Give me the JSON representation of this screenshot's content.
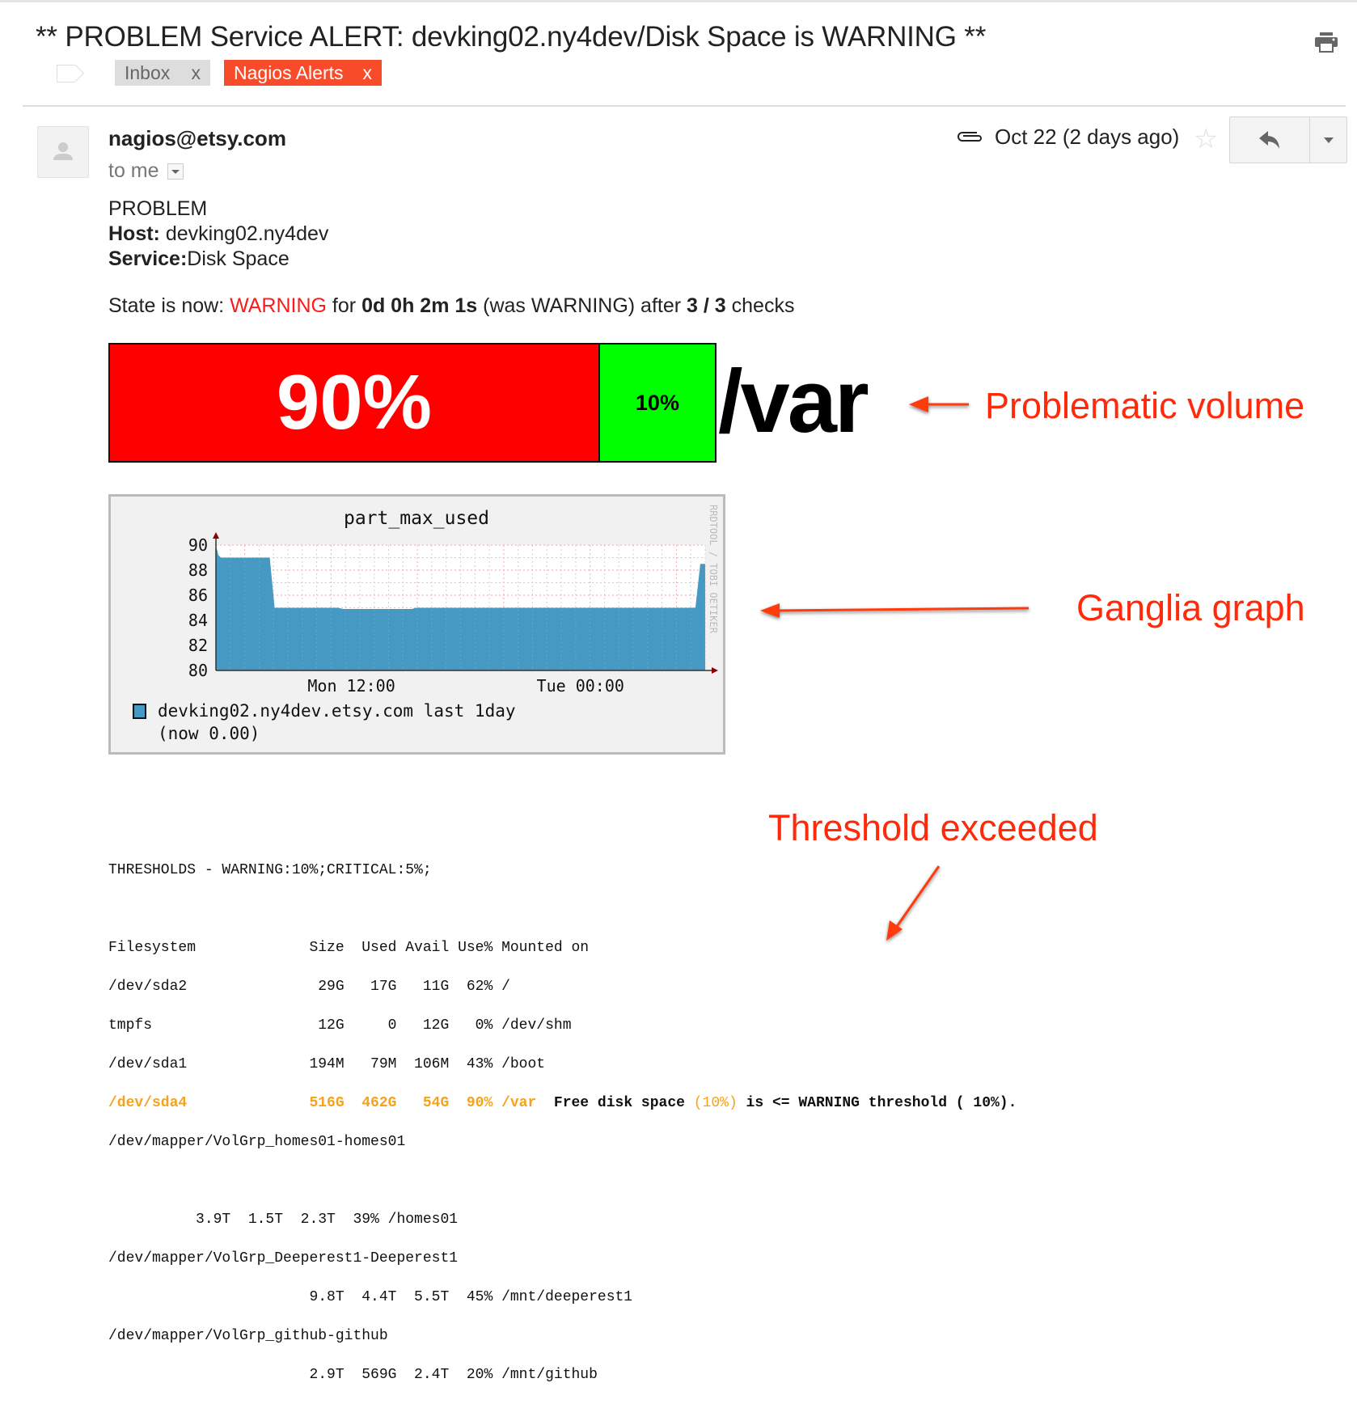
{
  "email": {
    "subject": "** PROBLEM Service ALERT: devking02.ny4dev/Disk Space is WARNING **",
    "labels": [
      {
        "name": "Inbox",
        "remove": "x",
        "color": "#dddddd"
      },
      {
        "name": "Nagios Alerts",
        "remove": "x",
        "color": "#f84b2a"
      }
    ],
    "sender": "nagios@etsy.com",
    "recipient": "to me",
    "date": "Oct 22 (2 days ago)",
    "icons": {
      "print": "print-icon",
      "attachment": "paperclip-icon",
      "star": "star-icon",
      "reply": "reply-icon",
      "more": "dropdown-icon"
    }
  },
  "body": {
    "line1": "PROBLEM",
    "host_label": "Host:",
    "host_value": " devking02.ny4dev",
    "service_label": "Service:",
    "service_value": "Disk Space",
    "state_prefix": "State is now: ",
    "state_value": "WARNING",
    "state_for": " for ",
    "duration": "0d 0h 2m 1s",
    "was": " (was WARNING) after ",
    "checks": "3 / 3",
    "checks_suffix": " checks"
  },
  "usage_bar": {
    "used_percent": 90,
    "free_percent": 10,
    "used_label": "90%",
    "free_label": "10%",
    "volume": "/var",
    "used_color": "#ff0000",
    "free_color": "#00ff00"
  },
  "annotations": {
    "problematic_volume": "Problematic volume",
    "ganglia_graph": "Ganglia graph",
    "threshold_exceeded": "Threshold exceeded",
    "color": "#ff2a0a"
  },
  "chart_data": {
    "type": "area",
    "title": "part_max_used",
    "ylim": [
      80,
      90
    ],
    "yticks": [
      80,
      82,
      84,
      86,
      88,
      90
    ],
    "xticks": [
      "Mon 12:00",
      "Tue 00:00"
    ],
    "x": [
      0,
      0.5,
      1,
      11,
      12,
      25,
      26,
      40,
      41,
      98,
      99,
      100
    ],
    "values": [
      90,
      89.2,
      89,
      89,
      85,
      85,
      84.9,
      84.9,
      85,
      85,
      88.5,
      88.5
    ],
    "x_units": "percent of 1-day window",
    "fill_color": "#4599c3",
    "grid": true,
    "legend": "devking02.ny4dev.etsy.com last 1day",
    "legend_sub": "(now 0.00)",
    "watermark": "RRDTOOL / TOBI OETIKER"
  },
  "df": {
    "thresholds": "THRESHOLDS - WARNING:10%;CRITICAL:5%;",
    "header": "Filesystem             Size  Used Avail Use% Mounted on",
    "rows": [
      "/dev/sda2               29G   17G   11G  62% /",
      "tmpfs                   12G     0   12G   0% /dev/shm",
      "/dev/sda1              194M   79M  106M  43% /boot"
    ],
    "warn_row": "/dev/sda4              516G  462G   54G  90% /var",
    "warn_msg_prefix": "  Free disk space ",
    "warn_msg_pct": "(10%)",
    "warn_msg_suffix": " is <= WARNING threshold ( 10%).",
    "rows2": [
      "/dev/mapper/VolGrp_homes01-homes01",
      "",
      "          3.9T  1.5T  2.3T  39% /homes01",
      "/dev/mapper/VolGrp_Deeperest1-Deeperest1",
      "                       9.8T  4.4T  5.5T  45% /mnt/deeperest1",
      "/dev/mapper/VolGrp_github-github",
      "                       2.9T  569G  2.4T  20% /mnt/github"
    ]
  }
}
